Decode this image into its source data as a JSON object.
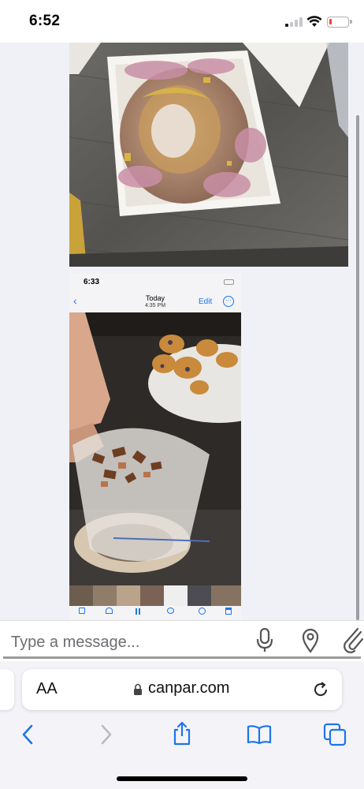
{
  "status_bar": {
    "time": "6:52",
    "signal_bars_active": 1,
    "battery_level": 0.08,
    "battery_color": "#ff3b30"
  },
  "conversation": {
    "attachments": [
      {
        "kind": "photo",
        "subject": "open pastry box with crushed cake"
      },
      {
        "kind": "screenshot",
        "status_time": "6:33",
        "header_title": "Today",
        "header_subtitle": "4:35 PM",
        "edit_label": "Edit",
        "subject": "hand holding cup of chocolate chunks, pastries on plate"
      }
    ]
  },
  "composer": {
    "placeholder": "Type a message..."
  },
  "browser": {
    "text_size_label": "AA",
    "domain": "canpar.com"
  },
  "colors": {
    "ios_blue": "#1e74e8",
    "composer_text": "#6d6d72",
    "page_bg": "#eff1f6"
  },
  "icons": [
    "back-icon",
    "forward-icon",
    "share-icon",
    "bookmarks-icon",
    "tabs-icon",
    "microphone-icon",
    "location-pin-icon",
    "paperclip-icon",
    "reload-icon",
    "lock-icon",
    "wifi-icon"
  ]
}
